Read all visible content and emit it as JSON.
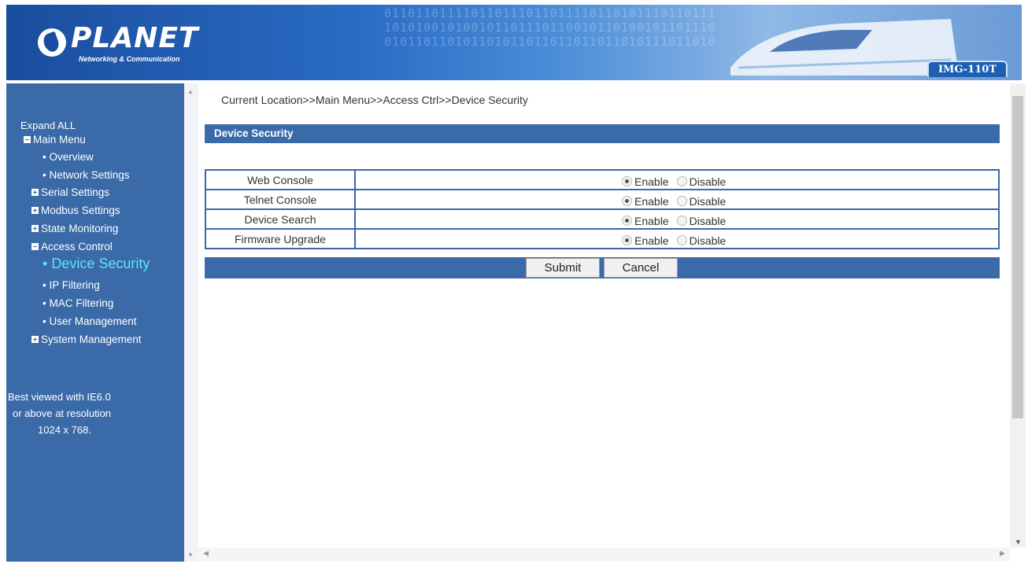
{
  "header": {
    "logo_text": "PLANET",
    "logo_subtitle": "Networking & Communication",
    "model": "IMG-110T",
    "binary_text": "0110110111101101110110111101101011101101110110101101101110\n1010100101001011011101100101101001011011101011011011101101\n0101101101011010110110110110110101110110101101101101101101"
  },
  "sidebar": {
    "expand_all": "Expand ALL",
    "items": [
      {
        "label": "Main Menu",
        "marker": "minus"
      },
      {
        "label": "Overview",
        "marker": "bullet"
      },
      {
        "label": "Network Settings",
        "marker": "bullet"
      },
      {
        "label": "Serial Settings",
        "marker": "plus"
      },
      {
        "label": "Modbus Settings",
        "marker": "plus"
      },
      {
        "label": "State Monitoring",
        "marker": "plus"
      },
      {
        "label": "Access Control",
        "marker": "minus"
      },
      {
        "label": "Device Security",
        "marker": "bullet",
        "current": true
      },
      {
        "label": "IP Filtering",
        "marker": "bullet"
      },
      {
        "label": "MAC Filtering",
        "marker": "bullet"
      },
      {
        "label": "User Management",
        "marker": "bullet"
      },
      {
        "label": "System Management",
        "marker": "plus"
      }
    ],
    "best_viewed": [
      "Best viewed with IE6.0",
      "or above at resolution",
      "1024 x 768."
    ]
  },
  "main": {
    "breadcrumb": "Current Location>>Main Menu>>Access Ctrl>>Device Security",
    "section_title": "Device Security",
    "rows": [
      {
        "label": "Web Console",
        "value": "Enable"
      },
      {
        "label": "Telnet Console",
        "value": "Enable"
      },
      {
        "label": "Device Search",
        "value": "Enable"
      },
      {
        "label": "Firmware Upgrade",
        "value": "Enable"
      }
    ],
    "enable_label": "Enable",
    "disable_label": "Disable",
    "submit_label": "Submit",
    "cancel_label": "Cancel"
  },
  "colors": {
    "nav_blue": "#3a6aa8",
    "current_item": "#5ee4f8"
  }
}
